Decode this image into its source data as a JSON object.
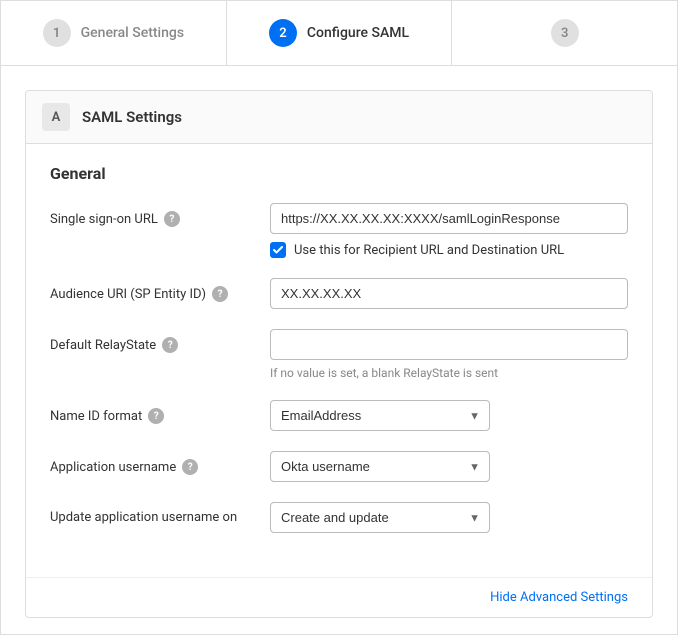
{
  "stepper": {
    "steps": [
      {
        "number": "1",
        "label": "General Settings",
        "state": "inactive"
      },
      {
        "number": "2",
        "label": "Configure SAML",
        "state": "active"
      },
      {
        "number": "3",
        "label": "",
        "state": "inactive"
      }
    ]
  },
  "section": {
    "letter": "A",
    "title": "SAML Settings",
    "group_label": "General"
  },
  "form": {
    "fields": [
      {
        "id": "sso-url",
        "label": "Single sign-on URL",
        "type": "text",
        "value": "https://XX.XX.XX.XX:XXXX/samlLoginResponse",
        "placeholder": "",
        "has_help": true,
        "has_checkbox": true,
        "checkbox_label": "Use this for Recipient URL and Destination URL",
        "checked": true
      },
      {
        "id": "audience-uri",
        "label": "Audience URI (SP Entity ID)",
        "type": "text",
        "value": "XX.XX.XX.XX",
        "placeholder": "",
        "has_help": true
      },
      {
        "id": "relay-state",
        "label": "Default RelayState",
        "type": "text",
        "value": "",
        "placeholder": "",
        "has_help": true,
        "hint": "If no value is set, a blank RelayState is sent"
      },
      {
        "id": "name-id-format",
        "label": "Name ID format",
        "type": "select",
        "value": "EmailAddress",
        "has_help": true
      },
      {
        "id": "app-username",
        "label": "Application username",
        "type": "select",
        "value": "Okta username",
        "has_help": true
      },
      {
        "id": "update-username-on",
        "label": "Update application username on",
        "type": "select",
        "value": "Create and update",
        "has_help": false
      }
    ]
  },
  "footer": {
    "link_label": "Hide Advanced Settings"
  },
  "icons": {
    "help": "?",
    "check": "✓",
    "dropdown": "▼"
  }
}
